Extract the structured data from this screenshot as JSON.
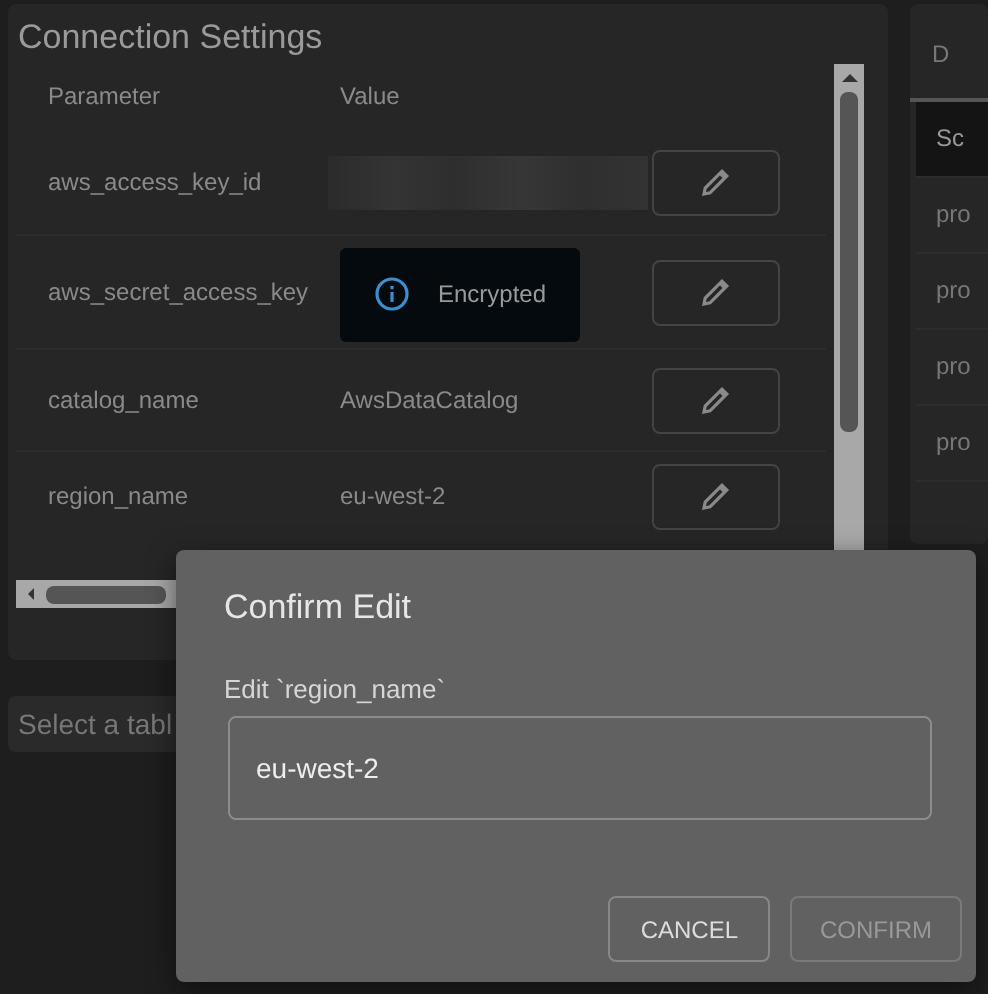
{
  "panel": {
    "title": "Connection Settings",
    "columns": [
      "Parameter",
      "Value"
    ],
    "rows": [
      {
        "name": "aws_access_key_id",
        "kind": "hidden"
      },
      {
        "name": "aws_secret_access_key",
        "kind": "encrypted",
        "value": "Encrypted"
      },
      {
        "name": "catalog_name",
        "kind": "text",
        "value": "AwsDataCatalog"
      },
      {
        "name": "region_name",
        "kind": "text",
        "value": "eu-west-2"
      }
    ]
  },
  "table_select": {
    "placeholder": "Select a tabl"
  },
  "side_panel": {
    "tab": "D",
    "items": [
      {
        "label": "Sc",
        "selected": true
      },
      {
        "label": "pro",
        "selected": false
      },
      {
        "label": "pro",
        "selected": false
      },
      {
        "label": "pro",
        "selected": false
      },
      {
        "label": "pro",
        "selected": false
      }
    ]
  },
  "dialog": {
    "title": "Confirm Edit",
    "field_label": "Edit `region_name`",
    "value": "eu-west-2",
    "buttons": [
      {
        "label": "CANCEL",
        "disabled": false
      },
      {
        "label": "CONFIRM",
        "disabled": true
      }
    ]
  }
}
